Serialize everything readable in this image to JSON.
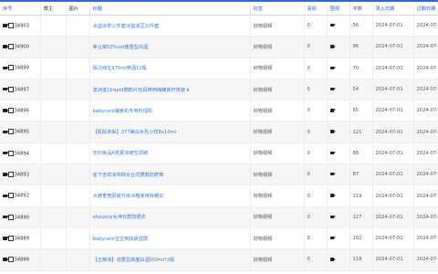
{
  "columns": [
    "序号",
    "博主",
    "图片",
    "标题",
    "标签",
    "喜欢",
    "围观",
    "字数",
    "录入日期",
    "过期日期"
  ],
  "sortable_columns": [
    0,
    3,
    4,
    5,
    6,
    7,
    8,
    9
  ],
  "colors": {
    "link": "#3d78d8",
    "header_link": "#2a60c8",
    "top_bar": "#2d6ad3",
    "stripe": "#f6f6f6"
  },
  "row_icon": "video-camera-icon",
  "rows": [
    {
      "id": "34903",
      "title": "冰益凉茶三件套冰益凉豆三件套",
      "tag": "好物视频",
      "likes": "0",
      "words": "56",
      "entered": "2024-07-01",
      "expires": "2024-07-06"
    },
    {
      "id": "34900",
      "title": "茅台镇53%vol酱香型白酒",
      "tag": "好物视频",
      "likes": "0",
      "words": "96",
      "entered": "2024-07-01",
      "expires": "2024-07-31"
    },
    {
      "id": "34899",
      "title": "珠江纯生975ml啤酒12瓶",
      "tag": "好物视频",
      "likes": "0",
      "words": "70",
      "entered": "2024-07-01",
      "expires": "2024-07-04"
    },
    {
      "id": "34897",
      "title": "澳洲进口rapid鹦鹉片玩具带西梅罐食杆饼装",
      "tag": "好物视频",
      "likes": "0",
      "words": "54",
      "entered": "2024-07-01",
      "expires": "2024-07-07",
      "info": "ℹ"
    },
    {
      "id": "34896",
      "title": "babycare辅食机专用料理机",
      "tag": "好物视频",
      "likes": "0",
      "words": "65",
      "entered": "2024-07-01",
      "expires": "2024-07-05"
    },
    {
      "id": "34895",
      "title": "【肌肤未来】377美白水乳小样8x10ml",
      "tag": "好物视频",
      "likes": "0",
      "words": "121",
      "entered": "2024-07-01",
      "expires": "2024-07-15"
    },
    {
      "id": "34894",
      "title": "无印良品A类夏凉被空调被",
      "tag": "好物视频",
      "likes": "0",
      "words": "88",
      "entered": "2024-07-01",
      "expires": "2024-07-06"
    },
    {
      "id": "34893",
      "title": "雀下吉祥凉帘棉女台式腰鼓防鼾棉",
      "tag": "好物视频",
      "likes": "0",
      "words": "87",
      "entered": "2024-07-01",
      "expires": "2024-07-07"
    },
    {
      "id": "34892",
      "title": "大牌宽宽厨房升级冰箱家用除蛾仪",
      "tag": "好物视频",
      "likes": "0",
      "words": "119",
      "entered": "2024-07-01",
      "expires": "2024-07-05"
    },
    {
      "id": "34890",
      "title": "ohsunny女神长款防晒衣",
      "tag": "好物视频",
      "likes": "0",
      "words": "127",
      "entered": "2024-07-01",
      "expires": "2024-07-05"
    },
    {
      "id": "34889",
      "title": "babycare宝宝爽肤锁湿屏",
      "tag": "好物视频",
      "likes": "0",
      "words": "102",
      "entered": "2024-07-01",
      "expires": "2024-07-05"
    },
    {
      "id": "34888",
      "title": "【五粮液】浓香型高度白酒500ml*2瓶",
      "tag": "好物视频",
      "likes": "0",
      "words": "118",
      "entered": "2024-07-01",
      "expires": "2024-07-04"
    }
  ]
}
